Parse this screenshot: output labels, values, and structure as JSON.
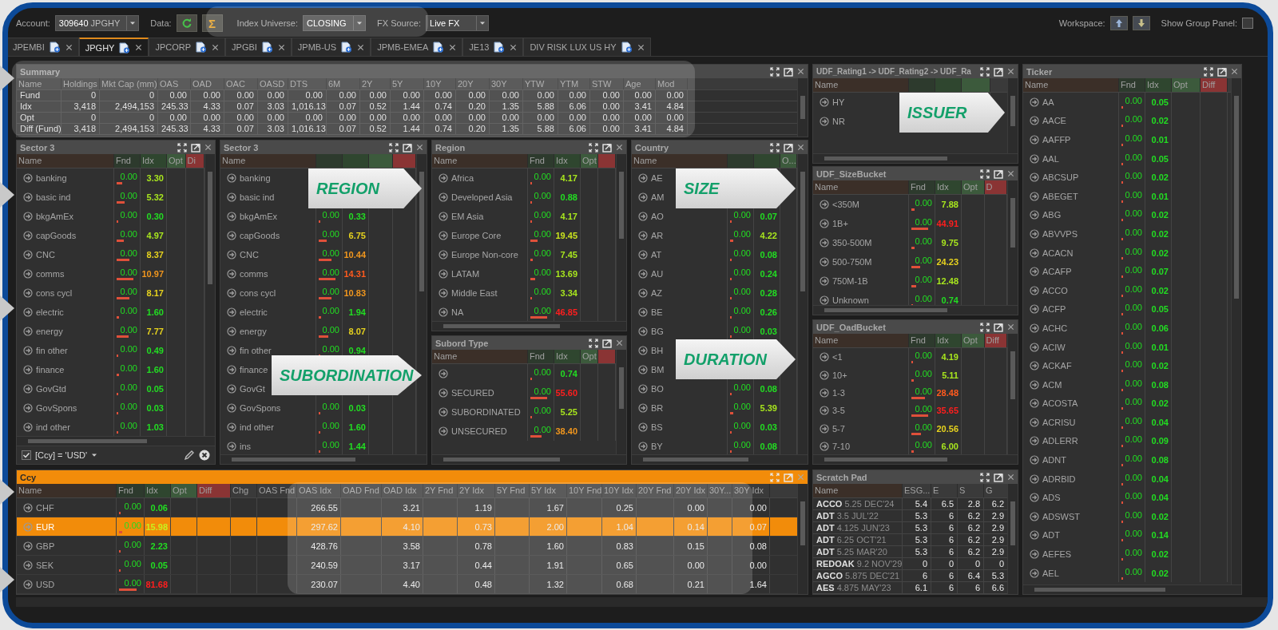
{
  "toolbar": {
    "account_label": "Account:",
    "account_number": "309640",
    "account_name": "JPGHY",
    "data_label": "Data:",
    "sum_button": "Σ",
    "index_universe_label": "Index Universe:",
    "index_universe": "CLOSING",
    "fx_source_label": "FX Source:",
    "fx_source": "Live FX",
    "workspace_label": "Workspace:",
    "show_group_panel_label": "Show Group Panel:",
    "show_group_panel_checked": false
  },
  "tabs": [
    {
      "label": "JPEMBI",
      "selected": false
    },
    {
      "label": "JPGHY",
      "selected": true
    },
    {
      "label": "JPCORP",
      "selected": false
    },
    {
      "label": "JPGBI",
      "selected": false
    },
    {
      "label": "JPMB-US",
      "selected": false
    },
    {
      "label": "JPMB-EMEA",
      "selected": false
    },
    {
      "label": "JE13",
      "selected": false
    },
    {
      "label": "DIV RISK LUX US HY",
      "selected": false
    }
  ],
  "panels": [
    {
      "kind": "summary",
      "title": "Summary",
      "active": false,
      "columns": [
        "Name",
        "Holdings",
        "Mkt Cap (mm)",
        "OAS",
        "OAD",
        "OAC",
        "OASD",
        "DTS",
        "6M",
        "2Y",
        "5Y",
        "10Y",
        "20Y",
        "30Y",
        "YTW",
        "YTM",
        "STW",
        "Age",
        "Mod"
      ],
      "rows": [
        [
          "Fund",
          "0",
          "0",
          "0.00",
          "0.00",
          "0.00",
          "0.00",
          "0.00",
          "0.00",
          "0.00",
          "0.00",
          "0.00",
          "0.00",
          "0.00",
          "0.00",
          "0.00",
          "0.00",
          "0.00",
          "0.00"
        ],
        [
          "Idx",
          "3,418",
          "2,494,153",
          "245.33",
          "4.33",
          "0.07",
          "3.03",
          "1,016.13",
          "0.07",
          "0.52",
          "1.44",
          "0.74",
          "0.20",
          "1.35",
          "5.88",
          "6.06",
          "0.00",
          "3.41",
          "4.84"
        ],
        [
          "Opt",
          "0",
          "0",
          "0.00",
          "0.00",
          "0.00",
          "0.00",
          "0.00",
          "0.00",
          "0.00",
          "0.00",
          "0.00",
          "0.00",
          "0.00",
          "0.00",
          "0.00",
          "0.00",
          "0.00",
          "0.00"
        ],
        [
          "Diff (Fund)",
          "3,418",
          "2,494,153",
          "245.33",
          "4.33",
          "0.07",
          "3.03",
          "1,016.13",
          "0.07",
          "0.52",
          "1.44",
          "0.74",
          "0.20",
          "1.35",
          "5.88",
          "6.06",
          "0.00",
          "3.41",
          "4.84"
        ]
      ]
    },
    {
      "kind": "bucket",
      "title": "Sector 3",
      "active": false,
      "columns": [
        {
          "kind": "name",
          "label": "Name"
        },
        {
          "kind": "fnd",
          "label": "Fnd"
        },
        {
          "kind": "idx",
          "label": "Idx"
        },
        {
          "kind": "opt",
          "label": "Opt"
        },
        {
          "kind": "diff",
          "label": "Di"
        }
      ],
      "rows": [
        {
          "name": "banking",
          "fnd": "0.00",
          "idx": "3.30",
          "level": 0.25,
          "color": "#a8e61e"
        },
        {
          "name": "basic ind",
          "fnd": "0.00",
          "idx": "5.32",
          "level": 0.38,
          "color": "#a8e61e"
        },
        {
          "name": "bkgAmEx",
          "fnd": "0.00",
          "idx": "0.30",
          "level": 0.03,
          "color": "#22dd22"
        },
        {
          "name": "capGoods",
          "fnd": "0.00",
          "idx": "4.97",
          "level": 0.36,
          "color": "#a8e61e"
        },
        {
          "name": "CNC",
          "fnd": "0.00",
          "idx": "8.37",
          "level": 0.6,
          "color": "#e6d21e"
        },
        {
          "name": "comms",
          "fnd": "0.00",
          "idx": "10.97",
          "level": 0.8,
          "color": "#f0961e"
        },
        {
          "name": "cons cycl",
          "fnd": "0.00",
          "idx": "8.17",
          "level": 0.6,
          "color": "#e6d21e"
        },
        {
          "name": "electric",
          "fnd": "0.00",
          "idx": "1.60",
          "level": 0.12,
          "color": "#22dd22"
        },
        {
          "name": "energy",
          "fnd": "0.00",
          "idx": "7.77",
          "level": 0.56,
          "color": "#e6d21e"
        },
        {
          "name": "fin other",
          "fnd": "0.00",
          "idx": "0.49",
          "level": 0.04,
          "color": "#22dd22"
        },
        {
          "name": "finance",
          "fnd": "0.00",
          "idx": "1.60",
          "level": 0.12,
          "color": "#22dd22"
        },
        {
          "name": "GovGtd",
          "fnd": "0.00",
          "idx": "0.05",
          "level": 0.02,
          "color": "#22dd22"
        },
        {
          "name": "GovSpons",
          "fnd": "0.00",
          "idx": "0.03",
          "level": 0.02,
          "color": "#22dd22"
        },
        {
          "name": "ind other",
          "fnd": "0.00",
          "idx": "1.03",
          "level": 0.08,
          "color": "#22dd22"
        }
      ],
      "filter": {
        "checked": true,
        "text": "[Ccy] = 'USD'"
      }
    },
    {
      "kind": "bucket",
      "title": "Sector 3",
      "active": false,
      "columns": [
        {
          "kind": "name",
          "label": "Name"
        },
        {
          "kind": "fnd"
        },
        {
          "kind": "idx"
        },
        {
          "kind": "opt"
        },
        {
          "kind": "diff"
        }
      ],
      "rows": [
        {
          "name": "banking"
        },
        {
          "name": "basic ind"
        },
        {
          "name": "bkgAmEx",
          "fnd": "0.00",
          "idx": "0.33",
          "level": 0.03,
          "color": "#22dd22"
        },
        {
          "name": "capGoods",
          "fnd": "0.00",
          "idx": "6.75",
          "level": 0.4,
          "color": "#e6d21e"
        },
        {
          "name": "CNC",
          "fnd": "0.00",
          "idx": "10.44",
          "level": 0.6,
          "color": "#f0961e"
        },
        {
          "name": "comms",
          "fnd": "0.00",
          "idx": "14.31",
          "level": 0.8,
          "color": "#ff5a1e"
        },
        {
          "name": "cons cycl",
          "fnd": "0.00",
          "idx": "10.83",
          "level": 0.6,
          "color": "#f0961e"
        },
        {
          "name": "electric",
          "fnd": "0.00",
          "idx": "1.94",
          "level": 0.11,
          "color": "#22dd22"
        },
        {
          "name": "energy",
          "fnd": "0.00",
          "idx": "8.07",
          "level": 0.45,
          "color": "#e6d21e"
        },
        {
          "name": "fin other",
          "fnd": "0.00",
          "idx": "0.94",
          "level": 0.05,
          "color": "#22dd22"
        },
        {
          "name": "finance"
        },
        {
          "name": "GovGt"
        },
        {
          "name": "GovSpons",
          "fnd": "0.00",
          "idx": "0.03",
          "level": 0.02,
          "color": "#22dd22"
        },
        {
          "name": "ind other",
          "fnd": "0.00",
          "idx": "1.60",
          "level": 0.09,
          "color": "#22dd22"
        },
        {
          "name": "ins",
          "fnd": "0.00",
          "idx": "1.44",
          "level": 0.08,
          "color": "#22dd22"
        }
      ]
    },
    {
      "kind": "bucket",
      "title": "Region",
      "active": false,
      "columns": [
        {
          "kind": "name",
          "label": "Name"
        },
        {
          "kind": "fnd",
          "label": "Fnd"
        },
        {
          "kind": "idx",
          "label": "Idx"
        },
        {
          "kind": "opt",
          "label": "Opt"
        },
        {
          "kind": "diff"
        }
      ],
      "rows": [
        {
          "name": "Africa",
          "fnd": "0.00",
          "idx": "4.17",
          "level": 0.08,
          "color": "#a8e61e"
        },
        {
          "name": "Developed Asia",
          "fnd": "0.00",
          "idx": "0.88",
          "level": 0.02,
          "color": "#22dd22"
        },
        {
          "name": "EM Asia",
          "fnd": "0.00",
          "idx": "4.17",
          "level": 0.08,
          "color": "#a8e61e"
        },
        {
          "name": "Europe Core",
          "fnd": "0.00",
          "idx": "19.45",
          "level": 0.33,
          "color": "#c8e21e"
        },
        {
          "name": "Europe Non-core",
          "fnd": "0.00",
          "idx": "7.45",
          "level": 0.13,
          "color": "#a8e61e"
        },
        {
          "name": "LATAM",
          "fnd": "0.00",
          "idx": "13.69",
          "level": 0.23,
          "color": "#a8e61e"
        },
        {
          "name": "Middle East",
          "fnd": "0.00",
          "idx": "3.34",
          "level": 0.06,
          "color": "#a8e61e"
        },
        {
          "name": "NA",
          "fnd": "0.00",
          "idx": "46.85",
          "level": 0.8,
          "color": "#ff1e1e"
        }
      ]
    },
    {
      "kind": "bucket",
      "title": "Subord Type",
      "active": false,
      "columns": [
        {
          "kind": "name",
          "label": "Name"
        },
        {
          "kind": "fnd",
          "label": "Fnd"
        },
        {
          "kind": "idx",
          "label": "Idx"
        },
        {
          "kind": "opt",
          "label": "Opt"
        },
        {
          "kind": "diff"
        }
      ],
      "rows": [
        {
          "fnd": "0.00",
          "idx": "0.74",
          "level": 0.02,
          "color": "#22dd22"
        },
        {
          "name": "SECURED",
          "fnd": "0.00",
          "idx": "55.60",
          "level": 0.8,
          "color": "#ff1e1e"
        },
        {
          "name": "SUBORDINATED",
          "fnd": "0.00",
          "idx": "5.25",
          "level": 0.08,
          "color": "#a8e61e"
        },
        {
          "name": "UNSECURED",
          "fnd": "0.00",
          "idx": "38.40",
          "level": 0.55,
          "color": "#f0961e"
        }
      ]
    },
    {
      "kind": "bucket",
      "title": "Country",
      "active": false,
      "columns": [
        {
          "kind": "name",
          "label": "Name"
        },
        {
          "kind": "fnd"
        },
        {
          "kind": "idx"
        },
        {
          "kind": "opt",
          "label": "O..."
        }
      ],
      "rows": [
        {
          "name": "AE"
        },
        {
          "name": "AM"
        },
        {
          "name": "AO",
          "fnd": "0.00",
          "idx": "0.07",
          "level": 0.02,
          "color": "#22dd22"
        },
        {
          "name": "AR",
          "fnd": "0.00",
          "idx": "4.22",
          "level": 0.15,
          "color": "#a8e61e"
        },
        {
          "name": "AT",
          "fnd": "0.00",
          "idx": "0.08",
          "level": 0.02,
          "color": "#22dd22"
        },
        {
          "name": "AU",
          "fnd": "0.00",
          "idx": "0.24",
          "level": 0.02,
          "color": "#22dd22"
        },
        {
          "name": "AZ",
          "fnd": "0.00",
          "idx": "0.28",
          "level": 0.02,
          "color": "#22dd22"
        },
        {
          "name": "BE",
          "fnd": "0.00",
          "idx": "0.26",
          "level": 0.02,
          "color": "#22dd22"
        },
        {
          "name": "BG",
          "fnd": "0.00",
          "idx": "0.03",
          "level": 0.02,
          "color": "#22dd22"
        },
        {
          "name": "BH"
        },
        {
          "name": "BM"
        },
        {
          "name": "BO",
          "fnd": "0.00",
          "idx": "0.08",
          "level": 0.02,
          "color": "#22dd22"
        },
        {
          "name": "BR",
          "fnd": "0.00",
          "idx": "5.39",
          "level": 0.15,
          "color": "#a8e61e"
        },
        {
          "name": "BS",
          "fnd": "0.00",
          "idx": "0.03",
          "level": 0.02,
          "color": "#22dd22"
        },
        {
          "name": "BY",
          "fnd": "0.00",
          "idx": "0.08",
          "level": 0.02,
          "color": "#22dd22"
        }
      ]
    },
    {
      "kind": "currency",
      "title": "Ccy",
      "active": true,
      "columns": [
        {
          "kind": "name",
          "label": "Name"
        },
        {
          "kind": "fnd",
          "label": "Fnd"
        },
        {
          "kind": "idx",
          "label": "Idx"
        },
        {
          "kind": "opt",
          "label": "Opt"
        },
        {
          "kind": "diff",
          "label": "Diff"
        },
        {
          "kind": "plain",
          "label": "Chg"
        },
        {
          "kind": "plain",
          "label": "OAS Fnd"
        },
        {
          "kind": "value",
          "label": "OAS Idx"
        },
        {
          "kind": "plain",
          "label": "OAD Fnd"
        },
        {
          "kind": "value",
          "label": "OAD Idx"
        },
        {
          "kind": "plain",
          "label": "2Y Fnd"
        },
        {
          "kind": "value",
          "label": "2Y Idx"
        },
        {
          "kind": "plain",
          "label": "5Y Fnd"
        },
        {
          "kind": "value",
          "label": "5Y Idx"
        },
        {
          "kind": "plain",
          "label": "10Y Fnd"
        },
        {
          "kind": "value",
          "label": "10Y Idx"
        },
        {
          "kind": "plain",
          "label": "20Y Fnd"
        },
        {
          "kind": "value",
          "label": "20Y Idx"
        },
        {
          "kind": "plain",
          "label": "30Y..."
        },
        {
          "kind": "value",
          "label": "30Y Idx"
        }
      ],
      "rows": [
        {
          "name": "CHF",
          "fnd": "0.00",
          "idx": "0.06",
          "level": 0.02,
          "color": "#22dd22",
          "selected": false,
          "values": [
            "266.55",
            "3.21",
            "1.19",
            "1.67",
            "0.25",
            "0.00",
            "0.00"
          ]
        },
        {
          "name": "EUR",
          "fnd": "0.00",
          "idx": "15.98",
          "level": 0.15,
          "color": "#c8f01e",
          "selected": true,
          "values": [
            "297.62",
            "4.10",
            "0.73",
            "2.00",
            "1.04",
            "0.14",
            "0.07"
          ]
        },
        {
          "name": "GBP",
          "fnd": "0.00",
          "idx": "2.23",
          "level": 0.02,
          "color": "#22dd22",
          "selected": false,
          "values": [
            "428.76",
            "3.58",
            "0.78",
            "1.60",
            "0.83",
            "0.15",
            "0.08"
          ]
        },
        {
          "name": "SEK",
          "fnd": "0.00",
          "idx": "0.05",
          "level": 0.02,
          "color": "#22dd22",
          "selected": false,
          "values": [
            "240.59",
            "3.17",
            "0.44",
            "1.91",
            "0.65",
            "0.00",
            "0.00"
          ]
        },
        {
          "name": "USD",
          "fnd": "0.00",
          "idx": "81.68",
          "level": 0.8,
          "color": "#ff1e1e",
          "selected": false,
          "values": [
            "230.07",
            "4.40",
            "0.48",
            "1.32",
            "0.68",
            "0.21",
            "1.64"
          ]
        }
      ]
    },
    {
      "kind": "bucket",
      "title": "UDF_Rating1 -> UDF_Rating2 -> UDF_Ra",
      "active": false,
      "columns": [
        {
          "kind": "name",
          "label": "Name"
        },
        {
          "kind": "fnd"
        },
        {
          "kind": "idx"
        },
        {
          "kind": "opt"
        }
      ],
      "rows": [
        {
          "name": "HY"
        },
        {
          "name": "NR"
        }
      ]
    },
    {
      "kind": "bucket",
      "title": "UDF_SizeBucket",
      "active": false,
      "columns": [
        {
          "kind": "name",
          "label": "Name"
        },
        {
          "kind": "fnd",
          "label": "Fnd"
        },
        {
          "kind": "idx",
          "label": "Idx"
        },
        {
          "kind": "opt",
          "label": "Opt"
        },
        {
          "kind": "diff",
          "label": "D"
        }
      ],
      "rows": [
        {
          "name": "<350M",
          "fnd": "0.00",
          "idx": "7.88",
          "level": 0.14,
          "color": "#a8e61e"
        },
        {
          "name": "1B+",
          "fnd": "0.00",
          "idx": "44.91",
          "level": 0.8,
          "color": "#ff1e1e"
        },
        {
          "name": "350-500M",
          "fnd": "0.00",
          "idx": "9.75",
          "level": 0.17,
          "color": "#a8e61e"
        },
        {
          "name": "500-750M",
          "fnd": "0.00",
          "idx": "24.23",
          "level": 0.43,
          "color": "#e6d21e"
        },
        {
          "name": "750M-1B",
          "fnd": "0.00",
          "idx": "12.48",
          "level": 0.22,
          "color": "#a8e61e"
        },
        {
          "name": "Unknown",
          "fnd": "0.00",
          "idx": "0.74",
          "level": 0.02,
          "color": "#22dd22"
        }
      ]
    },
    {
      "kind": "bucket",
      "title": "UDF_OadBucket",
      "active": false,
      "columns": [
        {
          "kind": "name",
          "label": "Name"
        },
        {
          "kind": "fnd",
          "label": "Fnd"
        },
        {
          "kind": "idx",
          "label": "Idx"
        },
        {
          "kind": "opt",
          "label": "Opt"
        },
        {
          "kind": "diff",
          "label": "Diff"
        }
      ],
      "rows": [
        {
          "name": "<1",
          "fnd": "0.00",
          "idx": "4.19",
          "level": 0.09,
          "color": "#a8e61e"
        },
        {
          "name": "10+",
          "fnd": "0.00",
          "idx": "5.11",
          "level": 0.11,
          "color": "#a8e61e"
        },
        {
          "name": "1-3",
          "fnd": "0.00",
          "idx": "28.48",
          "level": 0.64,
          "color": "#ff5a1e"
        },
        {
          "name": "3-5",
          "fnd": "0.00",
          "idx": "35.65",
          "level": 0.8,
          "color": "#ff1e1e"
        },
        {
          "name": "5-7",
          "fnd": "0.00",
          "idx": "20.56",
          "level": 0.46,
          "color": "#e6d21e"
        },
        {
          "name": "7-10",
          "fnd": "0.00",
          "idx": "6.00",
          "level": 0.13,
          "color": "#a8e61e"
        }
      ]
    },
    {
      "kind": "scratch",
      "title": "Scratch Pad",
      "active": false,
      "columns": [
        "Name",
        "ESG...",
        "E",
        "S",
        "G"
      ],
      "rows": [
        {
          "name": "**ACCO** 5.25 DEC'24",
          "values": [
            "5.4",
            "6.5",
            "2.8",
            "6.2"
          ]
        },
        {
          "name": "**ADT** 3.5 JUL'22",
          "values": [
            "5.3",
            "6",
            "6.2",
            "2.9"
          ]
        },
        {
          "name": "**ADT** 4.125 JUN'23",
          "values": [
            "5.3",
            "6",
            "6.2",
            "2.9"
          ]
        },
        {
          "name": "**ADT** 6.25 OCT'21",
          "values": [
            "5.3",
            "6",
            "6.2",
            "2.9"
          ]
        },
        {
          "name": "**ADT** 5.25 MAR'20",
          "values": [
            "5.3",
            "6",
            "6.2",
            "2.9"
          ]
        },
        {
          "name": "**REDOAK** 9.2 NOV'29",
          "values": [
            "0",
            "0",
            "0",
            "0"
          ]
        },
        {
          "name": "**AGCO** 5.875 DEC'21",
          "values": [
            "6",
            "6",
            "6.4",
            "5.3"
          ]
        },
        {
          "name": "**AES** 4.875 MAY'23",
          "values": [
            "6.1",
            "6",
            "6",
            "6.6"
          ]
        }
      ]
    },
    {
      "kind": "bucket",
      "title": "Ticker",
      "active": false,
      "columns": [
        {
          "kind": "name",
          "label": "Name"
        },
        {
          "kind": "fnd",
          "label": "Fnd"
        },
        {
          "kind": "idx",
          "label": "Idx"
        },
        {
          "kind": "opt",
          "label": "Opt"
        },
        {
          "kind": "diff",
          "label": "Diff"
        }
      ],
      "rows": [
        {
          "name": "AA",
          "fnd": "0.00",
          "idx": "0.05",
          "level": 0.02,
          "color": "#22dd22"
        },
        {
          "name": "AACE",
          "fnd": "0.00",
          "idx": "0.02",
          "level": 0.02,
          "color": "#22dd22"
        },
        {
          "name": "AAFFP",
          "fnd": "0.00",
          "idx": "0.01",
          "level": 0.02,
          "color": "#22dd22"
        },
        {
          "name": "AAL",
          "fnd": "0.00",
          "idx": "0.05",
          "level": 0.02,
          "color": "#22dd22"
        },
        {
          "name": "ABCSUP",
          "fnd": "0.00",
          "idx": "0.02",
          "level": 0.02,
          "color": "#22dd22"
        },
        {
          "name": "ABEGET",
          "fnd": "0.00",
          "idx": "0.01",
          "level": 0.02,
          "color": "#22dd22"
        },
        {
          "name": "ABG",
          "fnd": "0.00",
          "idx": "0.02",
          "level": 0.02,
          "color": "#22dd22"
        },
        {
          "name": "ABVVPS",
          "fnd": "0.00",
          "idx": "0.02",
          "level": 0.02,
          "color": "#22dd22"
        },
        {
          "name": "ACACN",
          "fnd": "0.00",
          "idx": "0.02",
          "level": 0.02,
          "color": "#22dd22"
        },
        {
          "name": "ACAFP",
          "fnd": "0.00",
          "idx": "0.07",
          "level": 0.02,
          "color": "#22dd22"
        },
        {
          "name": "ACCO",
          "fnd": "0.00",
          "idx": "0.02",
          "level": 0.02,
          "color": "#22dd22"
        },
        {
          "name": "ACFP",
          "fnd": "0.00",
          "idx": "0.05",
          "level": 0.02,
          "color": "#22dd22"
        },
        {
          "name": "ACHC",
          "fnd": "0.00",
          "idx": "0.06",
          "level": 0.02,
          "color": "#22dd22"
        },
        {
          "name": "ACIW",
          "fnd": "0.00",
          "idx": "0.01",
          "level": 0.02,
          "color": "#22dd22"
        },
        {
          "name": "ACKAF",
          "fnd": "0.00",
          "idx": "0.02",
          "level": 0.02,
          "color": "#22dd22"
        },
        {
          "name": "ACM",
          "fnd": "0.00",
          "idx": "0.08",
          "level": 0.02,
          "color": "#22dd22"
        },
        {
          "name": "ACOSTA",
          "fnd": "0.00",
          "idx": "0.02",
          "level": 0.02,
          "color": "#22dd22"
        },
        {
          "name": "ACRISU",
          "fnd": "0.00",
          "idx": "0.04",
          "level": 0.02,
          "color": "#22dd22"
        },
        {
          "name": "ADLERR",
          "fnd": "0.00",
          "idx": "0.09",
          "level": 0.02,
          "color": "#22dd22"
        },
        {
          "name": "ADNT",
          "fnd": "0.00",
          "idx": "0.08",
          "level": 0.02,
          "color": "#22dd22"
        },
        {
          "name": "ADRBID",
          "fnd": "0.00",
          "idx": "0.04",
          "level": 0.02,
          "color": "#22dd22"
        },
        {
          "name": "ADS",
          "fnd": "0.00",
          "idx": "0.04",
          "level": 0.02,
          "color": "#22dd22"
        },
        {
          "name": "ADSWST",
          "fnd": "0.00",
          "idx": "0.02",
          "level": 0.02,
          "color": "#22dd22"
        },
        {
          "name": "ADT",
          "fnd": "0.00",
          "idx": "0.14",
          "level": 0.05,
          "color": "#22dd22"
        },
        {
          "name": "AEFES",
          "fnd": "0.00",
          "idx": "0.02",
          "level": 0.02,
          "color": "#22dd22"
        },
        {
          "name": "AEL",
          "fnd": "0.00",
          "idx": "0.02",
          "level": 0.02,
          "color": "#22dd22"
        }
      ]
    }
  ],
  "callouts": [
    {
      "text": "ISSUER"
    },
    {
      "text": "REGION"
    },
    {
      "text": "SIZE"
    },
    {
      "text": "SUBORDINATION"
    },
    {
      "text": "DURATION"
    }
  ]
}
